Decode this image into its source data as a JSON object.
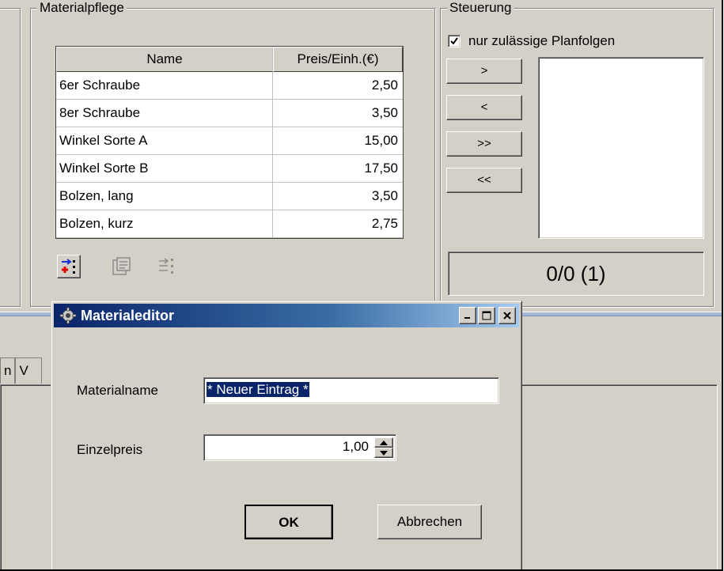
{
  "materialpflege": {
    "title": "Materialpflege",
    "columns": [
      "Name",
      "Preis/Einh.(€)"
    ],
    "rows": [
      {
        "name": "6er Schraube",
        "price": "2,50"
      },
      {
        "name": "8er Schraube",
        "price": "3,50"
      },
      {
        "name": "Winkel Sorte A",
        "price": "15,00"
      },
      {
        "name": "Winkel Sorte B",
        "price": "17,50"
      },
      {
        "name": "Bolzen, lang",
        "price": "3,50"
      },
      {
        "name": "Bolzen, kurz",
        "price": "2,75"
      }
    ],
    "toolbar_icons": [
      "add-item-icon",
      "edit-item-icon",
      "delete-item-icon"
    ]
  },
  "steuerung": {
    "title": "Steuerung",
    "checkbox_label": "nur zulässige Planfolgen",
    "checkbox_checked": true,
    "buttons": [
      ">",
      "<",
      ">>",
      "<<"
    ],
    "counter": "0/0 (1)"
  },
  "background_tabs": [
    "n",
    "V"
  ],
  "dialog": {
    "title": "Materialeditor",
    "materialname_label": "Materialname",
    "materialname_value": "* Neuer Eintrag *",
    "einzelpreis_label": "Einzelpreis",
    "einzelpreis_value": "1,00",
    "ok_label": "OK",
    "cancel_label": "Abbrechen",
    "window_buttons": [
      "minimize",
      "maximize",
      "close"
    ]
  },
  "colors": {
    "window_face": "#d4d0c8",
    "titlebar_start": "#0a246a",
    "titlebar_end": "#a6caf0",
    "selection": "#0a246a"
  }
}
